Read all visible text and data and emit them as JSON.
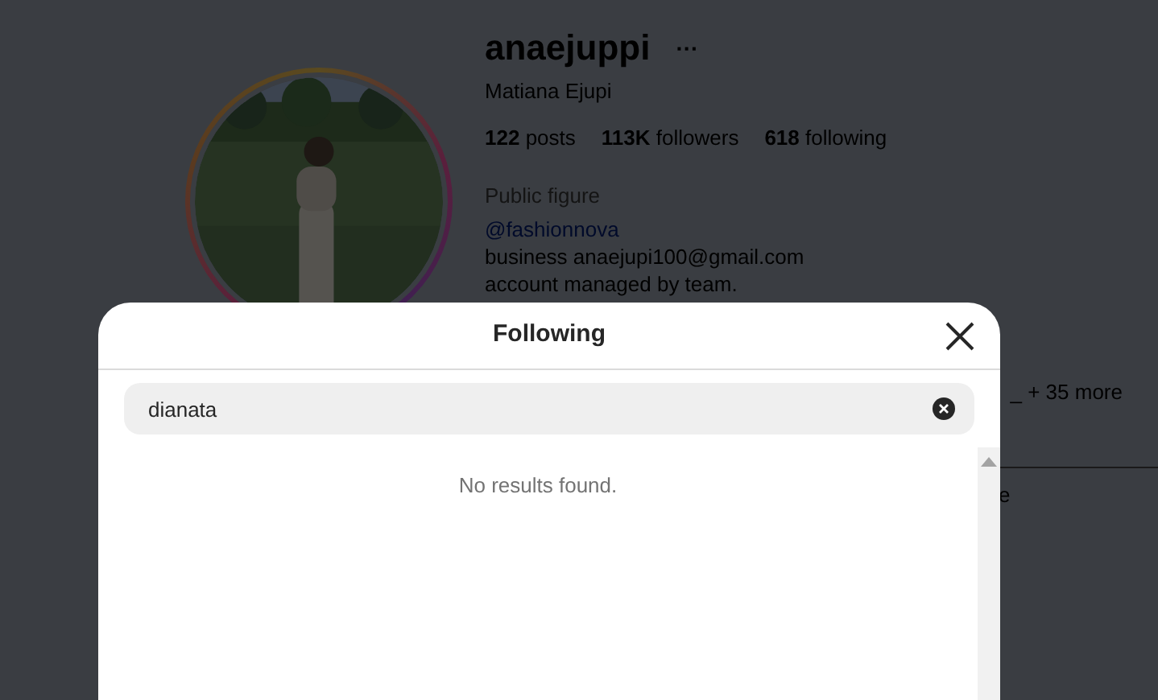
{
  "profile": {
    "username": "anaejuppi",
    "more": "···",
    "full_name": "Matiana Ejupi",
    "stats": [
      {
        "count": "122",
        "label": "posts"
      },
      {
        "count": "113K",
        "label": "followers"
      },
      {
        "count": "618",
        "label": "following"
      }
    ],
    "category": "Public figure",
    "link": "@fashionnova",
    "bio": [
      "business anaejupi100@gmail.com",
      "account managed by team."
    ],
    "followed_by": "_ + 35 more",
    "button_fragment": "e"
  },
  "modal": {
    "title": "Following",
    "search": {
      "value": "dianata"
    },
    "empty_message": "No results found."
  }
}
